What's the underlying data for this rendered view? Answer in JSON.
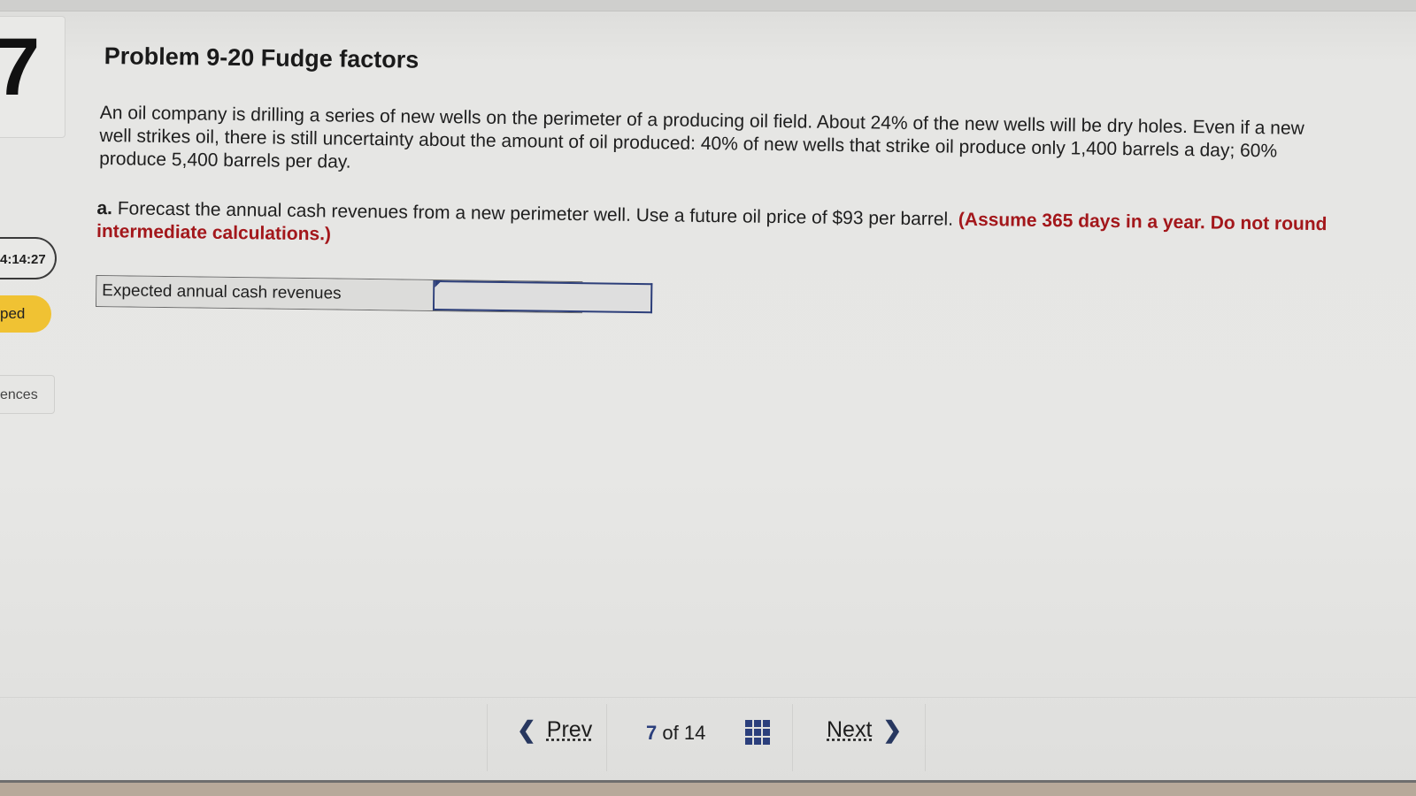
{
  "sidebar": {
    "question_number": "7",
    "timer": "4:14:27",
    "status_label": "ped",
    "references_label": "ences"
  },
  "problem": {
    "title": "Problem 9-20 Fudge factors",
    "body": "An oil company is drilling a series of new wells on the perimeter of a producing oil field. About 24% of the new wells will be dry holes. Even if a new well strikes oil, there is still uncertainty about the amount of oil produced: 40% of new wells that strike oil produce only 1,400 barrels a day; 60% produce 5,400 barrels per day.",
    "part_label": "a.",
    "part_text": "Forecast the annual cash revenues from a new perimeter well. Use a future oil price of $93 per barrel.",
    "part_note": "(Assume 365 days in a year. Do not round intermediate calculations.)"
  },
  "answer": {
    "label": "Expected annual cash revenues",
    "value": ""
  },
  "nav": {
    "prev_label": "Prev",
    "current_page": "7",
    "of_label": "of",
    "total_pages": "14",
    "next_label": "Next"
  },
  "colors": {
    "accent": "#2b3f7c",
    "note_red": "#a3171b",
    "status_yellow": "#f0c233"
  }
}
